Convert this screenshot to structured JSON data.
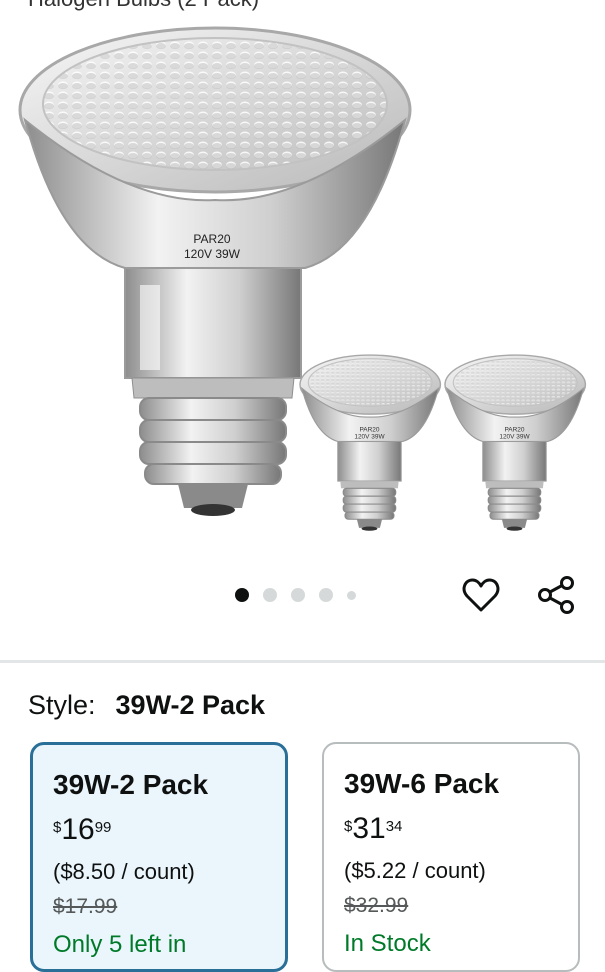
{
  "header": {
    "product_title_partial": "Halogen Bulbs (2 Pack)"
  },
  "image": {
    "main_bulb_label_line1": "PAR20",
    "main_bulb_label_line2": "120V 39W",
    "small_bulb_label_line1": "PAR20",
    "small_bulb_label_line2": "120V 39W"
  },
  "carousel": {
    "count": 5,
    "active_index": 0
  },
  "actions": {
    "favorite_icon": "heart-icon",
    "share_icon": "share-icon"
  },
  "style": {
    "label": "Style:",
    "selected": "39W-2 Pack"
  },
  "options": [
    {
      "title": "39W-2 Pack",
      "price_symbol": "$",
      "price_whole": "16",
      "price_fraction": "99",
      "unit_price": "($8.50 / count)",
      "list_price": "$17.99",
      "availability": "Only 5 left in"
    },
    {
      "title": "39W-6 Pack",
      "price_symbol": "$",
      "price_whole": "31",
      "price_fraction": "34",
      "unit_price": "($5.22 / count)",
      "list_price": "$32.99",
      "availability": "In Stock"
    }
  ],
  "colors": {
    "accent_border": "#2a6f97",
    "selected_bg": "#eaf6fc",
    "stock_green": "#007a29"
  }
}
